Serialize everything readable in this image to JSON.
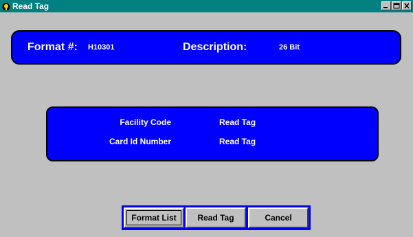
{
  "window": {
    "title": "Read Tag",
    "controls": {
      "minimize_icon": "minimize-icon",
      "maximize_icon": "maximize-icon",
      "close_icon": "close-icon"
    }
  },
  "header": {
    "format_label": "Format #:",
    "format_value": "H10301",
    "description_label": "Description:",
    "description_value": "26 Bit"
  },
  "info": {
    "facility_code_label": "Facility Code",
    "facility_code_value": "Read Tag",
    "card_id_label": "Card Id Number",
    "card_id_value": "Read Tag"
  },
  "buttons": {
    "format_list": "Format List",
    "read_tag": "Read Tag",
    "cancel": "Cancel"
  },
  "colors": {
    "titlebar": "#008080",
    "panel": "#0000ff",
    "window_bg": "#c0c0c0",
    "text_on_panel": "#ffffff"
  }
}
